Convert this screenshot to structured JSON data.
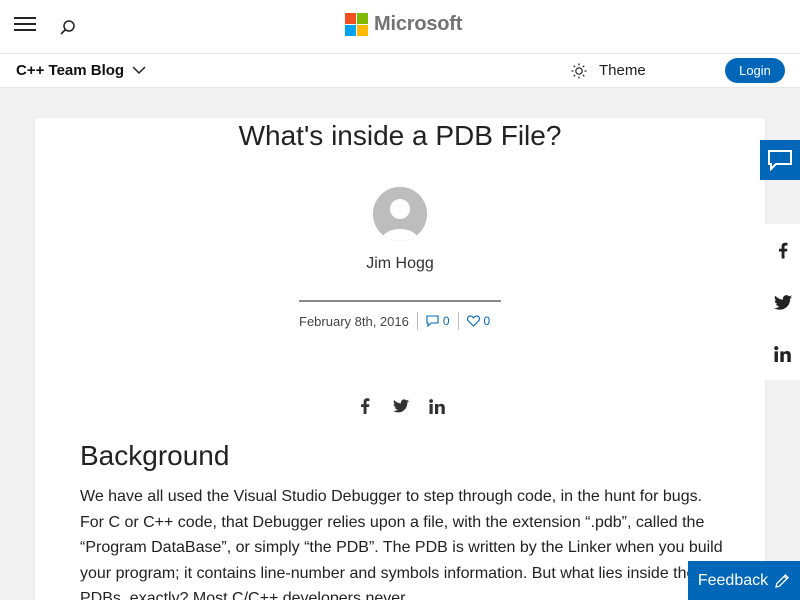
{
  "header": {
    "brand": "Microsoft",
    "brand_colors": [
      "#f25022",
      "#7fba00",
      "#00a4ef",
      "#ffb900"
    ],
    "menu_icon": "hamburger-icon",
    "search_icon": "search-icon"
  },
  "blog_nav": {
    "blog_name": "C++ Team Blog",
    "theme_label": "Theme",
    "login_label": "Login"
  },
  "article": {
    "title": "What's inside a PDB File?",
    "author": "Jim Hogg",
    "date": "February 8th, 2016",
    "comment_count": "0",
    "like_count": "0",
    "section_heading": "Background",
    "body": "We have all used the Visual Studio Debugger to step through code, in the hunt for bugs.  For C or C++ code, that Debugger relies upon a file, with the extension “.pdb”, called the “Program DataBase”, or simply “the PDB”.  The PDB is written by the Linker when you build your program; it contains line-number and symbols information. But what lies inside these PDBs, exactly? Most C/C++ developers never"
  },
  "floating": {
    "feedback_label": "Feedback"
  },
  "colors": {
    "accent": "#0067b8"
  }
}
